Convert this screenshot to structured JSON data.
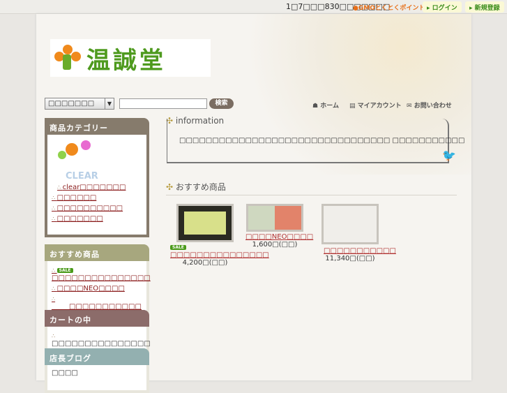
{
  "topbar": {
    "message": "1□7□□□830□□□□□□□",
    "gmo_logo": "GMOとくとくポイント",
    "login": "ログイン",
    "register": "新規登録"
  },
  "header": {
    "logo_text": "温誠堂"
  },
  "search": {
    "select_value": "□□□□□□□",
    "input_value": "",
    "button": "検索"
  },
  "nav": {
    "home": "ホーム",
    "account": "マイアカウント",
    "contact": "お問い合わせ"
  },
  "sidebar": {
    "categories": {
      "title": "商品カテゴリー",
      "image_text": "CLEAR",
      "items": [
        "clear□□□□□□□",
        "□□□□□□",
        "□□□□□□□□□□",
        "□□□□□□□"
      ]
    },
    "recommended": {
      "title": "おすすめ商品",
      "sale_badge": "SALE",
      "items": [
        "□□□□□□□□□□□□□□□",
        "□□□□NEO□□□□",
        "□□□□□□□□□□□"
      ]
    },
    "cart": {
      "title": "カートの中",
      "items": [
        "□□□□□□□□□□□□□□□"
      ]
    },
    "blog": {
      "title": "店長ブログ",
      "text": "□□□□"
    }
  },
  "main": {
    "info_title": "information",
    "info_text": "□□□□□□□□□□□□□□□□□□□□□□□□□□□□□□□□ □□□□□□□□□□□",
    "recommended_title": "おすすめ商品",
    "products": [
      {
        "name": "□□□□□□□□□□□□□□□",
        "price": "4,200□(□□)",
        "sale": "SALE"
      },
      {
        "name": "□□□□NEO□□□□",
        "price": "1,600□(□□)"
      },
      {
        "name": "□□□□□□□□□□□",
        "price": "11,340□(□□)"
      }
    ]
  }
}
